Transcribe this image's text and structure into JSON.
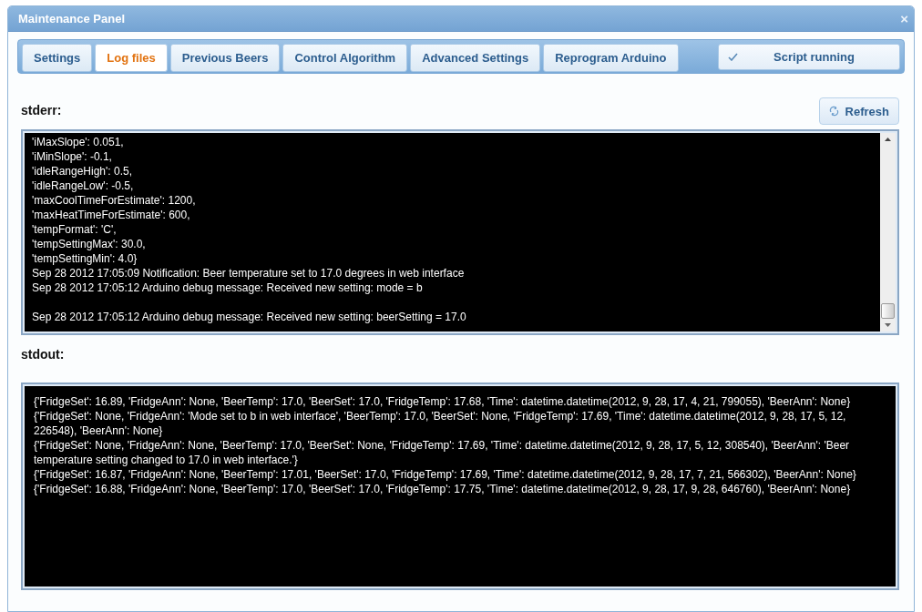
{
  "dialog": {
    "title": "Maintenance Panel",
    "close": "×"
  },
  "tabs": [
    {
      "label": "Settings",
      "selected": false
    },
    {
      "label": "Log files",
      "selected": true
    },
    {
      "label": "Previous Beers",
      "selected": false
    },
    {
      "label": "Control Algorithm",
      "selected": false
    },
    {
      "label": "Advanced Settings",
      "selected": false
    },
    {
      "label": "Reprogram Arduino",
      "selected": false
    }
  ],
  "status_button": {
    "label": "Script running",
    "checked": true
  },
  "stderr": {
    "heading": "stderr:",
    "refresh": "Refresh",
    "blocks": [
      [
        "'iMaxSlope': 0.051,",
        "'iMinSlope': -0.1,",
        "'idleRangeHigh': 0.5,",
        "'idleRangeLow': -0.5,",
        "'maxCoolTimeForEstimate': 1200,",
        "'maxHeatTimeForEstimate': 600,",
        "'tempFormat': 'C',",
        "'tempSettingMax': 30.0,",
        "'tempSettingMin': 4.0}",
        "Sep 28 2012 17:05:09 Notification: Beer temperature set to 17.0 degrees in web interface",
        "Sep 28 2012 17:05:12 Arduino debug message: Received new setting: mode = b"
      ],
      [
        "Sep 28 2012 17:05:12 Arduino debug message: Received new setting: beerSetting = 17.0"
      ]
    ]
  },
  "stdout": {
    "heading": "stdout:",
    "records": [
      "{'FridgeSet': 16.89, 'FridgeAnn': None, 'BeerTemp': 17.0, 'BeerSet': 17.0, 'FridgeTemp': 17.68, 'Time': datetime.datetime(2012, 9, 28, 17, 4, 21, 799055), 'BeerAnn': None}",
      "{'FridgeSet': None, 'FridgeAnn': 'Mode set to b in web interface', 'BeerTemp': 17.0, 'BeerSet': None, 'FridgeTemp': 17.69, 'Time': datetime.datetime(2012, 9, 28, 17, 5, 12, 226548), 'BeerAnn': None}",
      "{'FridgeSet': None, 'FridgeAnn': None, 'BeerTemp': 17.0, 'BeerSet': None, 'FridgeTemp': 17.69, 'Time': datetime.datetime(2012, 9, 28, 17, 5, 12, 308540), 'BeerAnn': 'Beer temperature setting changed to 17.0 in web interface.'}",
      "{'FridgeSet': 16.87, 'FridgeAnn': None, 'BeerTemp': 17.01, 'BeerSet': 17.0, 'FridgeTemp': 17.69, 'Time': datetime.datetime(2012, 9, 28, 17, 7, 21, 566302), 'BeerAnn': None}",
      "{'FridgeSet': 16.88, 'FridgeAnn': None, 'BeerTemp': 17.0, 'BeerSet': 17.0, 'FridgeTemp': 17.75, 'Time': datetime.datetime(2012, 9, 28, 17, 9, 28, 646760), 'BeerAnn': None}"
    ]
  }
}
